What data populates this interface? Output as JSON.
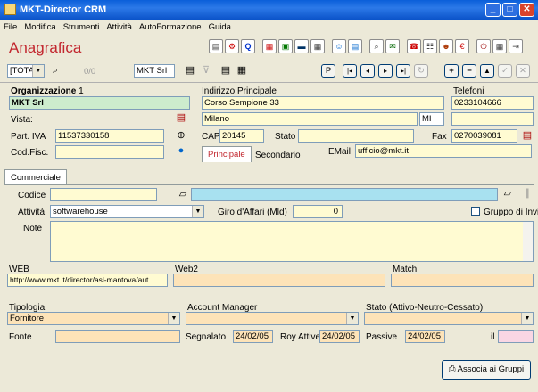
{
  "window": {
    "title": "MKT-Director CRM",
    "min": "_",
    "max": "□",
    "close": "✕"
  },
  "menu": [
    "File",
    "Modifica",
    "Strumenti",
    "Attività",
    "AutoFormazione",
    "Guida"
  ],
  "page": {
    "title": "Anagrafica"
  },
  "nav": {
    "filter": "[TOTALE]",
    "counter": "0/0",
    "search": "MKT Srl",
    "p": "P"
  },
  "org": {
    "label": "Organizzazione",
    "number": "1",
    "name": "MKT Srl",
    "vista_label": "Vista:",
    "piva_label": "Part. IVA",
    "piva": "11537330158",
    "cf_label": "Cod.Fisc."
  },
  "addr": {
    "label": "Indirizzo Principale",
    "street": "Corso Sempione 33",
    "city": "Milano",
    "prov": "MI",
    "cap_label": "CAP",
    "cap": "20145",
    "stato_label": "Stato",
    "tab1": "Principale",
    "tab2": "Secondario"
  },
  "tel": {
    "label": "Telefoni",
    "phone": "0233104666",
    "fax_label": "Fax",
    "fax": "0270039081",
    "email_label": "EMail",
    "email": "ufficio@mkt.it"
  },
  "comm": {
    "tab": "Commerciale",
    "codice_label": "Codice",
    "attivita_label": "Attività",
    "attivita": "softwarehouse",
    "giro_label": "Giro d'Affari (Mld)",
    "giro": "0",
    "gruppo_label": "Gruppo di Invio",
    "note_label": "Note"
  },
  "web": {
    "web_label": "WEB",
    "web": "http://www.mkt.it/director/asl-mantova/aut",
    "web2_label": "Web2",
    "match_label": "Match"
  },
  "bottom": {
    "tipologia_label": "Tipologia",
    "tipologia": "Fornitore",
    "am_label": "Account Manager",
    "stato_label": "Stato (Attivo-Neutro-Cessato)",
    "fonte_label": "Fonte",
    "segnalato_label": "Segnalato",
    "segnalato": "24/02/05",
    "roy_label": "Roy Attive",
    "roy": "24/02/05",
    "passive_label": "Passive",
    "passive": "24/02/05",
    "il_label": "il",
    "associa": "Associa ai Gruppi"
  },
  "colors": {
    "accent": "#c2262e",
    "field": "#fffbd2",
    "green": "#cdeccd",
    "orange": "#fde3b8",
    "teal": "#a8e1f0"
  }
}
